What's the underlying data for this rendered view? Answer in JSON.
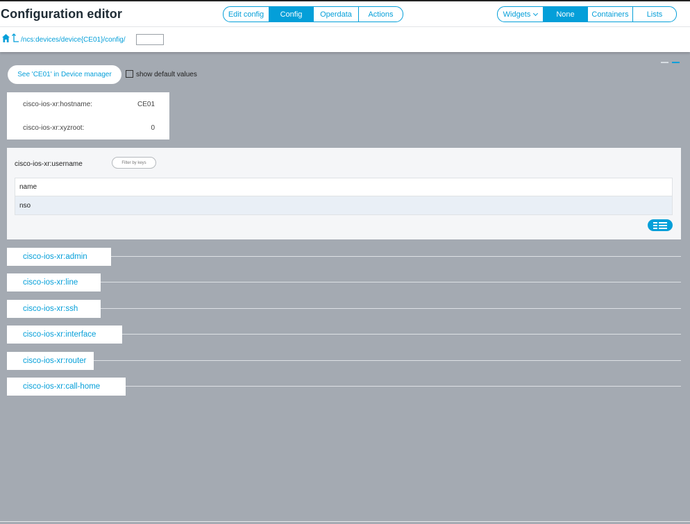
{
  "header": {
    "title": "Configuration editor",
    "nav_tabs": [
      {
        "label": "Edit config",
        "active": false
      },
      {
        "label": "Config",
        "active": true
      },
      {
        "label": "Operdata",
        "active": false
      },
      {
        "label": "Actions",
        "active": false
      }
    ],
    "widget_tabs": [
      {
        "label": "Widgets",
        "active": false,
        "dropdown": true
      },
      {
        "label": "None",
        "active": true
      },
      {
        "label": "Containers",
        "active": false
      },
      {
        "label": "Lists",
        "active": false
      }
    ]
  },
  "path": {
    "text": "/ncs:devices/device{CE01}/config/",
    "input_value": ""
  },
  "toolbar": {
    "device_manager_label": "See 'CE01' in Device manager",
    "show_defaults_label": "show default values",
    "show_defaults_checked": false
  },
  "leaves": [
    {
      "name": "cisco-ios-xr:hostname:",
      "value": "CE01"
    },
    {
      "name": "cisco-ios-xr:xyzroot:",
      "value": "0"
    }
  ],
  "list": {
    "title": "cisco-ios-xr:username",
    "filter_label": "Filter by keys",
    "columns": [
      "name"
    ],
    "rows": [
      [
        "nso"
      ]
    ]
  },
  "containers": [
    "cisco-ios-xr:admin",
    "cisco-ios-xr:line",
    "cisco-ios-xr:ssh",
    "cisco-ios-xr:interface",
    "cisco-ios-xr:router",
    "cisco-ios-xr:call-home"
  ],
  "colors": {
    "accent": "#049fd9",
    "background": "#a4aab2",
    "title": "#1e2b34"
  }
}
